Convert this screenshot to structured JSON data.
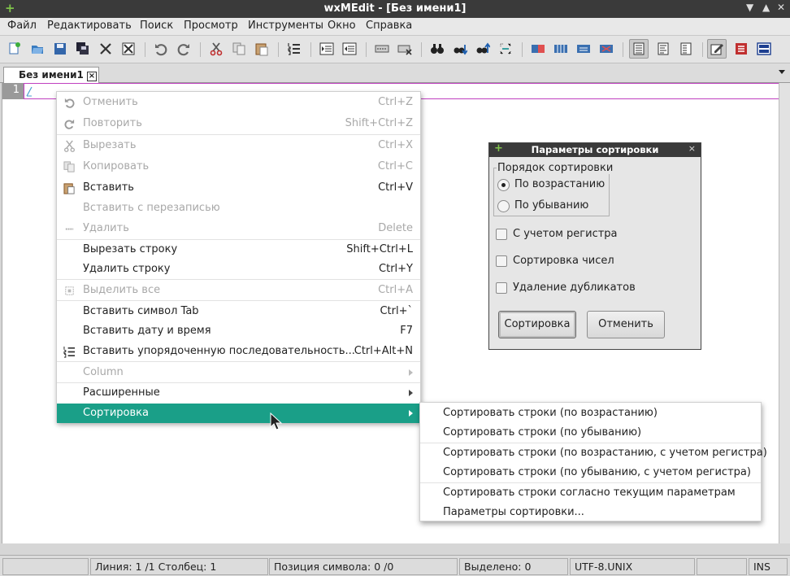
{
  "window": {
    "title": "wxMEdit - [Без имени1]"
  },
  "menubar": [
    "Файл",
    "Редактировать",
    "Поиск",
    "Просмотр",
    "Инструменты",
    "Окно",
    "Справка"
  ],
  "tab": {
    "label": "Без имени1"
  },
  "editor": {
    "line_number": "1"
  },
  "context_menu": {
    "undo": {
      "label": "Отменить",
      "shortcut": "Ctrl+Z"
    },
    "redo": {
      "label": "Повторить",
      "shortcut": "Shift+Ctrl+Z"
    },
    "cut": {
      "label": "Вырезать",
      "shortcut": "Ctrl+X"
    },
    "copy": {
      "label": "Копировать",
      "shortcut": "Ctrl+C"
    },
    "paste": {
      "label": "Вставить",
      "shortcut": "Ctrl+V"
    },
    "paste_overwrite": {
      "label": "Вставить с перезаписью"
    },
    "delete": {
      "label": "Удалить",
      "shortcut": "Delete"
    },
    "cut_line": {
      "label": "Вырезать строку",
      "shortcut": "Shift+Ctrl+L"
    },
    "delete_line": {
      "label": "Удалить строку",
      "shortcut": "Ctrl+Y"
    },
    "select_all": {
      "label": "Выделить все",
      "shortcut": "Ctrl+A"
    },
    "insert_tab": {
      "label": "Вставить символ Tab",
      "shortcut": "Ctrl+`"
    },
    "insert_datetime": {
      "label": "Вставить дату и время",
      "shortcut": "F7"
    },
    "insert_sequence": {
      "label": "Вставить упорядоченную последовательность...",
      "shortcut": "Ctrl+Alt+N"
    },
    "column": {
      "label": "Column"
    },
    "advanced": {
      "label": "Расширенные"
    },
    "sort": {
      "label": "Сортировка"
    }
  },
  "sort_submenu": {
    "asc": "Сортировать строки (по возрастанию)",
    "desc": "Сортировать строки (по убыванию)",
    "asc_case": "Сортировать строки  (по возрастанию, с учетом регистра)",
    "desc_case": "Сортировать строки  (по убыванию, с учетом регистра)",
    "current": "Сортировать строки согласно текущим параметрам",
    "options": "Параметры сортировки..."
  },
  "sort_dialog": {
    "title": "Параметры сортировки",
    "order_group": "Порядок сортировки",
    "asc": "По возрастанию",
    "desc": "По убыванию",
    "selected_order": "asc",
    "case_sensitive": {
      "label": "С учетом регистра",
      "checked": false
    },
    "numeric": {
      "label": "Сортировка чисел",
      "checked": false
    },
    "remove_duplicates": {
      "label": "Удаление дубликатов",
      "checked": false
    },
    "sort_button": "Сортировка",
    "cancel_button": "Отменить"
  },
  "statusbar": {
    "line_col": "Линия: 1 /1 Столбец: 1",
    "char_pos": "Позиция символа: 0 /0",
    "selected": "Выделено: 0",
    "encoding": "UTF-8.UNIX",
    "mode": "INS"
  },
  "colors": {
    "selection": "#1a9f88",
    "title_bar": "#3a3a3a",
    "current_line_border": "#c040c0"
  }
}
